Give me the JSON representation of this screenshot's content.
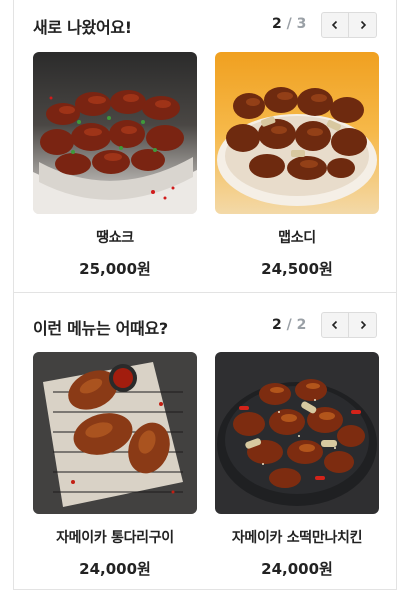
{
  "sections": [
    {
      "title": "새로 나왔어요!",
      "pager": {
        "current": "2",
        "separator": "/",
        "total": "3"
      },
      "products": [
        {
          "name": "땡쇼크",
          "price": "25,000원",
          "image": "spicy-chicken-platter"
        },
        {
          "name": "맵소디",
          "price": "24,500원",
          "image": "glazed-chicken-plate"
        }
      ]
    },
    {
      "title": "이런 메뉴는 어때요?",
      "pager": {
        "current": "2",
        "separator": "/",
        "total": "2"
      },
      "products": [
        {
          "name": "자메이카 통다리구이",
          "price": "24,000원",
          "image": "grilled-drumsticks"
        },
        {
          "name": "자메이카 소떡만나치킨",
          "price": "24,000원",
          "image": "sauced-chicken-dark-plate"
        }
      ]
    }
  ],
  "icons": {
    "prev": "chevron-left-icon",
    "next": "chevron-right-icon"
  },
  "colors": {
    "pager_muted": "#9aa0a6",
    "border": "#e3e3e3",
    "nav_bg": "#f4f4f4"
  }
}
